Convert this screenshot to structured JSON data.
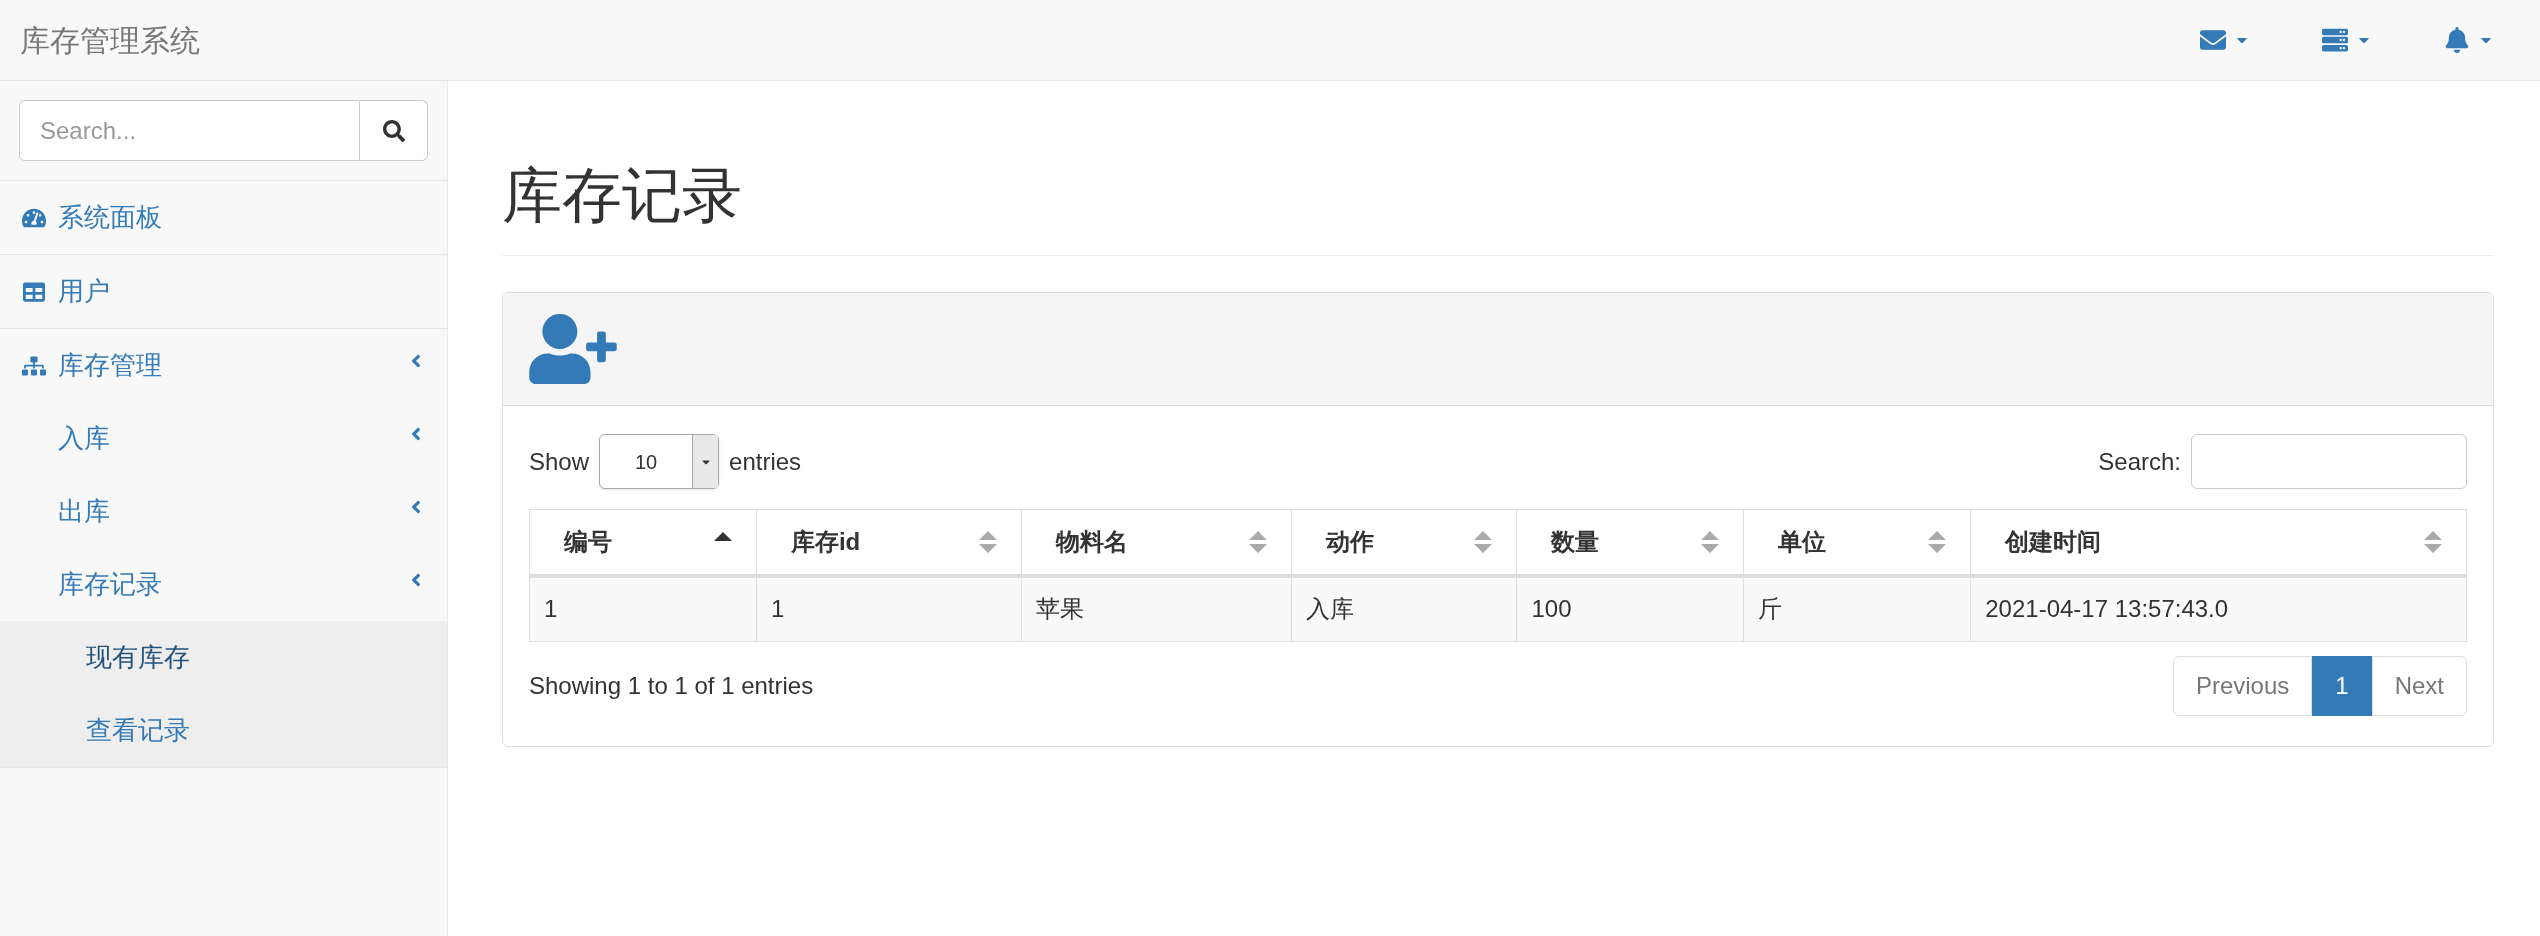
{
  "navbar": {
    "brand": "库存管理系统",
    "tools": [
      {
        "kind": "envelope"
      },
      {
        "kind": "tasks"
      },
      {
        "kind": "bell"
      }
    ]
  },
  "sidebar": {
    "search": {
      "placeholder": "Search..."
    },
    "items": [
      {
        "label": "系统面板",
        "kind": "dashboard",
        "expandable": false,
        "selected": false
      },
      {
        "label": "用户",
        "kind": "table",
        "expandable": false,
        "selected": false
      },
      {
        "label": "库存管理",
        "kind": "sitemap",
        "expandable": true,
        "selected": false,
        "children": [
          {
            "label": "入库",
            "expandable": true,
            "selected": false
          },
          {
            "label": "出库",
            "expandable": true,
            "selected": false
          },
          {
            "label": "库存记录",
            "expandable": true,
            "selected": false,
            "children": [
              {
                "label": "现有库存",
                "expandable": false,
                "selected": true
              },
              {
                "label": "查看记录",
                "expandable": false,
                "selected": false
              }
            ]
          }
        ]
      }
    ]
  },
  "page": {
    "title": "库存记录"
  },
  "panel": {
    "length": {
      "before": "Show",
      "value": "10",
      "after": "entries"
    },
    "search": {
      "label": "Search:"
    },
    "table": {
      "columns": [
        {
          "label": "编号",
          "sorted": true
        },
        {
          "label": "库存id",
          "sorted": false
        },
        {
          "label": "物料名",
          "sorted": false
        },
        {
          "label": "动作",
          "sorted": false
        },
        {
          "label": "数量",
          "sorted": false
        },
        {
          "label": "单位",
          "sorted": false
        },
        {
          "label": "创建时间",
          "sorted": false
        }
      ],
      "rows": [
        [
          "1",
          "1",
          "苹果",
          "入库",
          "100",
          "斤",
          "2021-04-17 13:57:43.0"
        ]
      ]
    },
    "info": "Showing 1 to 1 of 1 entries",
    "pagination": [
      {
        "label": "Previous",
        "kind": "prev",
        "selected": false
      },
      {
        "label": "1",
        "kind": "page",
        "selected": true
      },
      {
        "label": "Next",
        "kind": "next",
        "selected": false
      }
    ]
  }
}
